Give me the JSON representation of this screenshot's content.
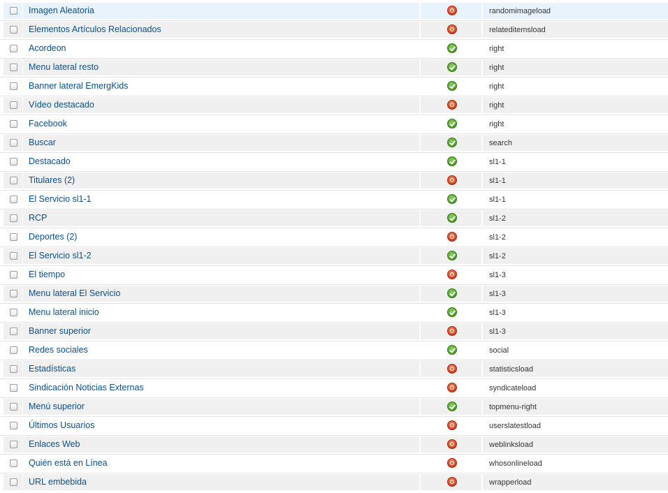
{
  "colors": {
    "title_link": "#0b4f87",
    "published": "#4a9a22",
    "unpublished": "#d0401c",
    "row_alt": "#f0f0f0",
    "row_selected": "#e9f3fd"
  },
  "modules": [
    {
      "title": "Imagen Aleatoria",
      "published": false,
      "position": "randomimageload"
    },
    {
      "title": "Elementos Artículos Relacionados",
      "published": false,
      "position": "relateditemsload"
    },
    {
      "title": "Acordeon",
      "published": true,
      "position": "right"
    },
    {
      "title": "Menu lateral resto",
      "published": true,
      "position": "right"
    },
    {
      "title": "Banner lateral EmergKids",
      "published": true,
      "position": "right"
    },
    {
      "title": "Vídeo destacado",
      "published": false,
      "position": "right"
    },
    {
      "title": "Facebook",
      "published": true,
      "position": "right"
    },
    {
      "title": "Buscar",
      "published": true,
      "position": "search"
    },
    {
      "title": "Destacado",
      "published": true,
      "position": "sl1-1"
    },
    {
      "title": "Titulares (2)",
      "published": false,
      "position": "sl1-1"
    },
    {
      "title": "El Servicio sl1-1",
      "published": true,
      "position": "sl1-1"
    },
    {
      "title": "RCP",
      "published": true,
      "position": "sl1-2"
    },
    {
      "title": "Deportes (2)",
      "published": false,
      "position": "sl1-2"
    },
    {
      "title": "El Servicio sl1-2",
      "published": true,
      "position": "sl1-2"
    },
    {
      "title": "El tiempo",
      "published": false,
      "position": "sl1-3"
    },
    {
      "title": "Menu lateral El Servicio",
      "published": true,
      "position": "sl1-3"
    },
    {
      "title": "Menu lateral inicio",
      "published": true,
      "position": "sl1-3"
    },
    {
      "title": "Banner superior",
      "published": false,
      "position": "sl1-3"
    },
    {
      "title": "Redes sociales",
      "published": true,
      "position": "social"
    },
    {
      "title": "Estadísticas",
      "published": false,
      "position": "statisticsload"
    },
    {
      "title": "Sindicación Noticias Externas",
      "published": false,
      "position": "syndicateload"
    },
    {
      "title": "Menú superior",
      "published": true,
      "position": "topmenu-right"
    },
    {
      "title": "Últimos Usuarios",
      "published": false,
      "position": "userslatestload"
    },
    {
      "title": "Enlaces Web",
      "published": false,
      "position": "weblinksload"
    },
    {
      "title": "Quién está en Línea",
      "published": false,
      "position": "whosonlineload"
    },
    {
      "title": "URL embebida",
      "published": false,
      "position": "wrapperload"
    }
  ]
}
